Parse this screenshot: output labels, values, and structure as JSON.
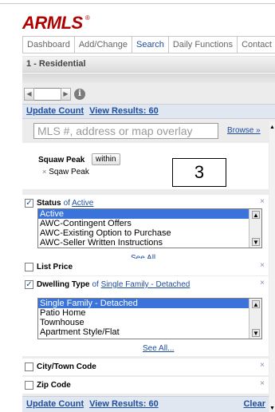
{
  "brand": {
    "logo_text": "ARMLS",
    "logo_mark": "®",
    "color": "#b00000"
  },
  "nav": {
    "tabs": [
      {
        "label": "Dashboard"
      },
      {
        "label": "Add/Change"
      },
      {
        "label": "Search",
        "active": true
      },
      {
        "label": "Daily Functions"
      },
      {
        "label": "Contact"
      }
    ]
  },
  "breadcrumb": {
    "text": "1 - Residential"
  },
  "pager": {
    "prev_icon": "chevron-left-icon",
    "next_icon": "chevron-right-icon",
    "info_icon": "info-icon"
  },
  "actions": {
    "update_count": "Update Count",
    "view_results": "View Results: 60"
  },
  "search": {
    "placeholder": "MLS #, address or map overlay",
    "browse": "Browse »"
  },
  "location": {
    "title": "Squaw Peak",
    "within_button": "within",
    "item": "Sqaw Peak"
  },
  "callout": {
    "number": "3"
  },
  "status": {
    "label": "Status",
    "of_text": "of",
    "value": "Active",
    "checked": true,
    "options": [
      "Active",
      "AWC-Contingent Offers",
      "AWC-Existing Option to Purchase",
      "AWC-Seller Written Instructions"
    ],
    "selected": "Active",
    "see_all": "See All..."
  },
  "list_price": {
    "label": "List Price",
    "checked": false
  },
  "dwelling": {
    "label": "Dwelling Type",
    "of_text": "of",
    "value": "Single Family - Detached",
    "checked": true,
    "options": [
      "Single Family - Detached",
      "Patio Home",
      "Townhouse",
      "Apartment Style/Flat"
    ],
    "selected": "Single Family - Detached",
    "see_all": "See All..."
  },
  "city": {
    "label": "City/Town Code",
    "checked": false
  },
  "zip": {
    "label": "Zip Code",
    "checked": false
  },
  "bottom": {
    "update_count": "Update Count",
    "view_results": "View Results: 60",
    "clear": "Clear"
  },
  "colors": {
    "accent": "#1d4d9e",
    "selected_bg": "#3a73d9",
    "panel_bg": "#ececec",
    "action_bar_bg": "#e0e7f0"
  }
}
